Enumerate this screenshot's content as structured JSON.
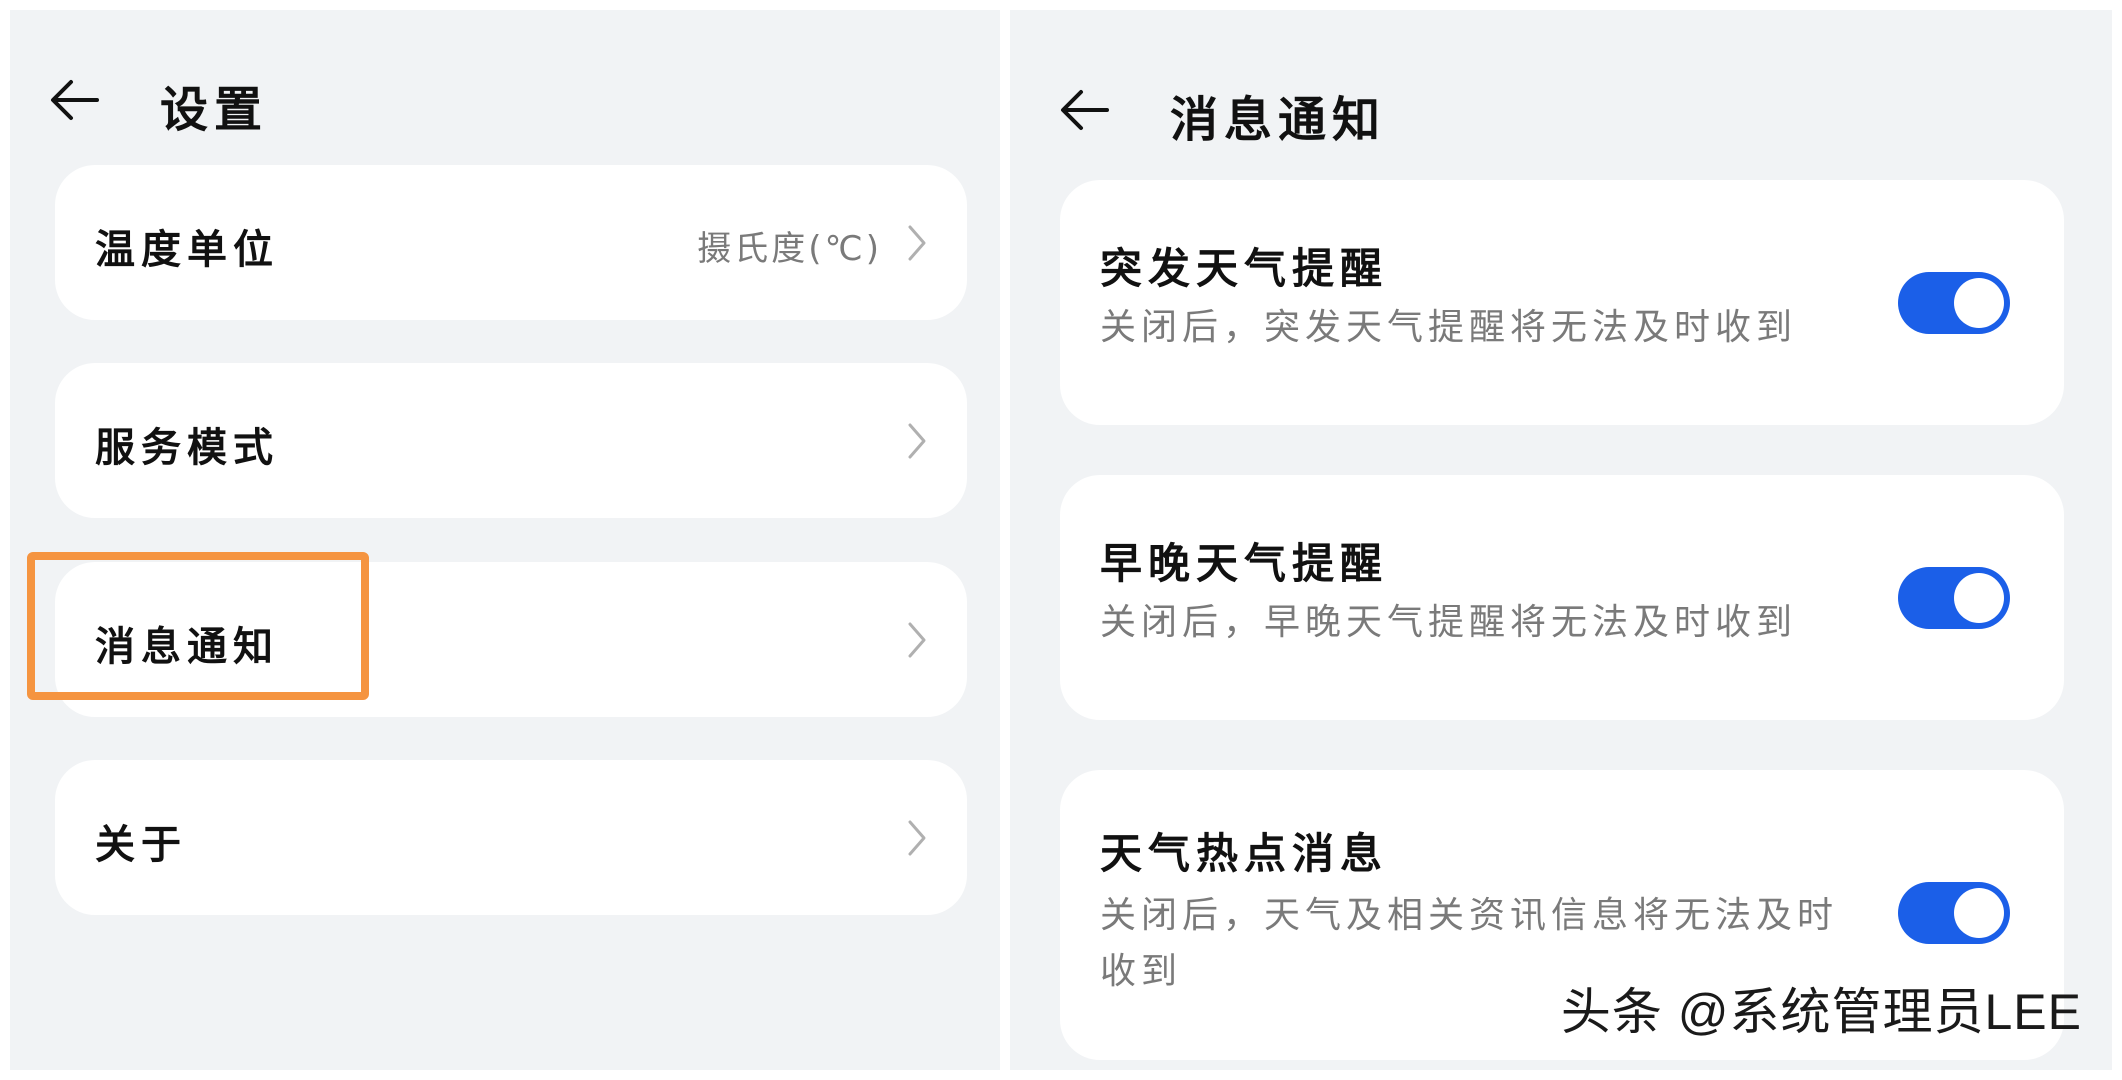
{
  "settings": {
    "title": "设置",
    "items": [
      {
        "label": "温度单位",
        "value": "摄氏度(℃)"
      },
      {
        "label": "服务模式",
        "value": ""
      },
      {
        "label": "消息通知",
        "value": ""
      },
      {
        "label": "关于",
        "value": ""
      }
    ]
  },
  "notifications": {
    "title": "消息通知",
    "items": [
      {
        "title": "突发天气提醒",
        "description": "关闭后，突发天气提醒将无法及时收到",
        "enabled": true
      },
      {
        "title": "早晚天气提醒",
        "description": "关闭后，早晚天气提醒将无法及时收到",
        "enabled": true
      },
      {
        "title": "天气热点消息",
        "description": "关闭后，天气及相关资讯信息将无法及时收到",
        "enabled": true
      }
    ]
  },
  "watermark": "头条 @系统管理员LEE",
  "colors": {
    "highlight": "#f59440",
    "toggle_on": "#1b5fe8",
    "panel_bg": "#f1f3f5"
  }
}
